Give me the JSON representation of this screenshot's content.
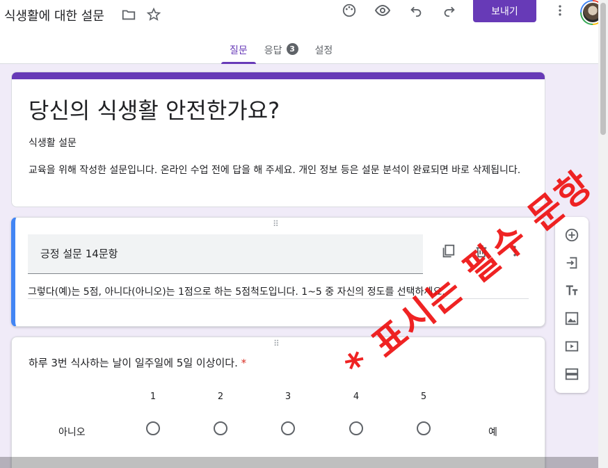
{
  "header": {
    "form_title": "식생활에 대한 설문",
    "send_label": "보내기",
    "icons": [
      "folder-icon",
      "star-icon",
      "palette-icon",
      "preview-eye-icon",
      "undo-icon",
      "redo-icon",
      "more-vert-icon"
    ]
  },
  "tabs": [
    {
      "label": "질문",
      "active": true
    },
    {
      "label": "응답",
      "badge": "3"
    },
    {
      "label": "설정"
    }
  ],
  "form": {
    "heading": "당신의 식생활 안전한가요?",
    "subtitle": "식생활 설문",
    "description": "교육을 위해 작성한 설문입니다. 온라인 수업 전에 답을 해 주세요. 개인 정보 등은 설문 분석이 완료되면 바로 삭제됩니다."
  },
  "section": {
    "title": "긍정 설문 14문항",
    "description": "그렇다(예)는 5점, 아니다(아니오)는 1점으로 하는 5점척도입니다. 1~5 중 자신의 정도를 선택하세요."
  },
  "question": {
    "title": "하루 3번 식사하는 날이 일주일에 5일 이상이다.",
    "required_mark": "*",
    "scale": [
      "1",
      "2",
      "3",
      "4",
      "5"
    ],
    "min_label": "아니오",
    "max_label": "예"
  },
  "annotation": {
    "text": "* 표시는 필수 문항"
  },
  "colors": {
    "accent": "#673ab7",
    "section_border": "#4285f4",
    "annotation": "#ee1111",
    "page_bg": "#f0ebf8"
  },
  "toolbar_icons": [
    "add-question-icon",
    "import-questions-icon",
    "add-title-icon",
    "add-image-icon",
    "add-video-icon",
    "add-section-icon"
  ]
}
